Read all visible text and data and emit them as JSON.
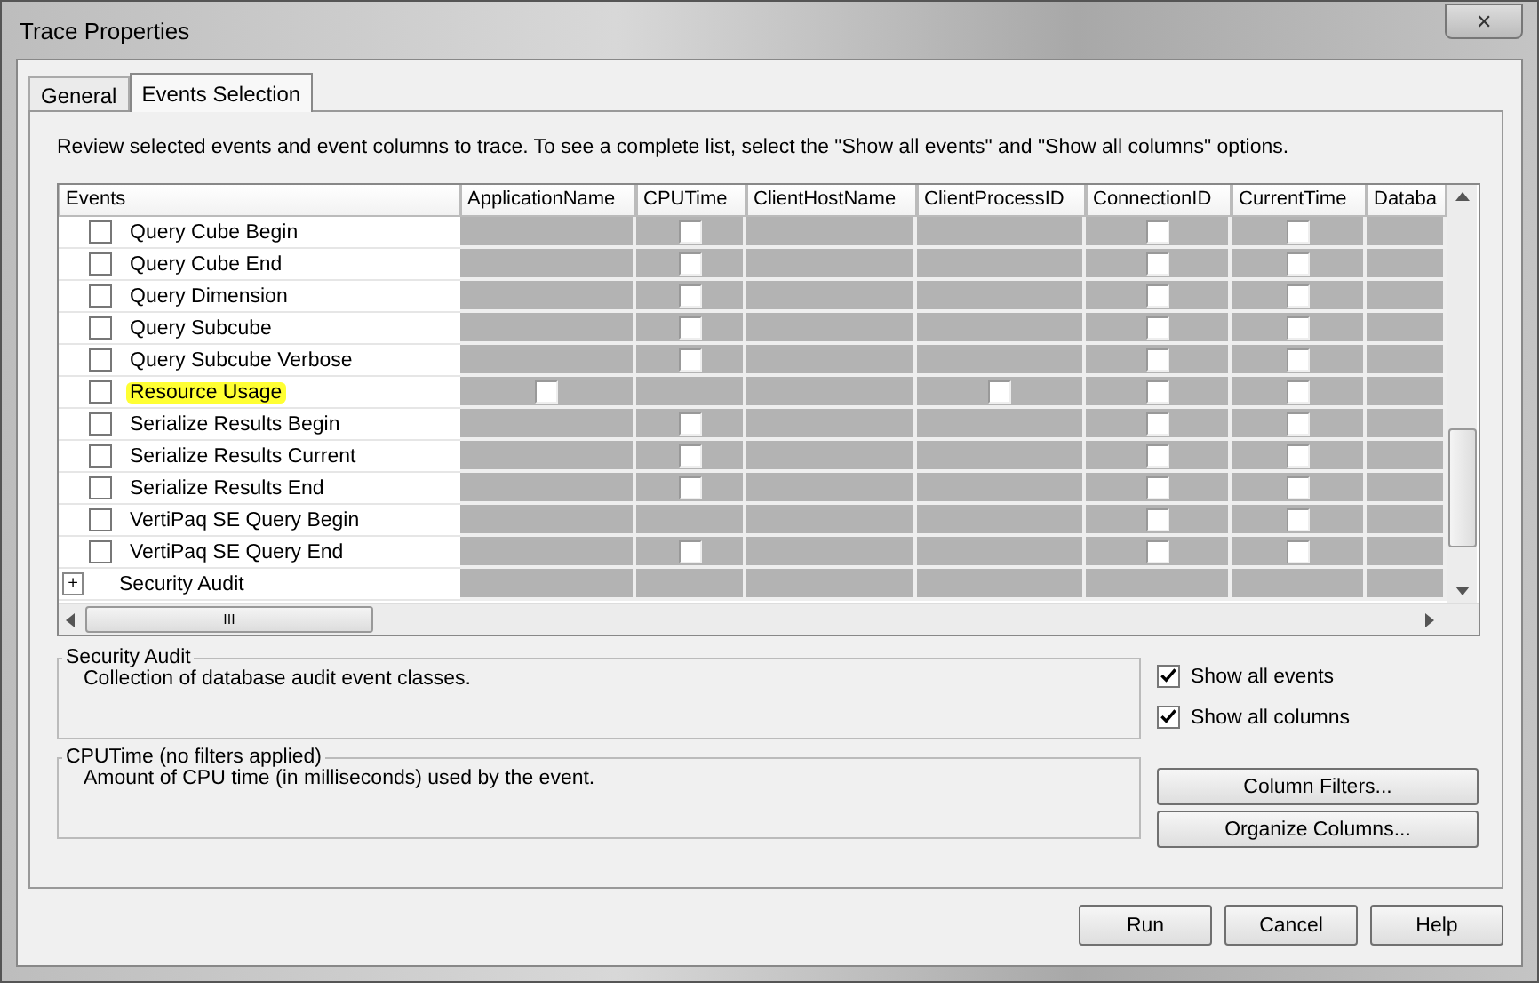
{
  "window": {
    "title": "Trace Properties",
    "close": "✕"
  },
  "tabs": [
    {
      "label": "General",
      "selected": false
    },
    {
      "label": "Events Selection",
      "selected": true
    }
  ],
  "description": "Review selected events and event columns to trace. To see a complete list, select the \"Show all events\" and \"Show all columns\" options.",
  "grid": {
    "columns": [
      "Events",
      "ApplicationName",
      "CPUTime",
      "ClientHostName",
      "ClientProcessID",
      "ConnectionID",
      "CurrentTime",
      "Databa"
    ],
    "rows": [
      {
        "event": "Query Cube Begin",
        "checked": false,
        "highlighted": false,
        "cells": [
          false,
          true,
          false,
          false,
          true,
          true,
          false
        ]
      },
      {
        "event": "Query Cube End",
        "checked": false,
        "highlighted": false,
        "cells": [
          false,
          true,
          false,
          false,
          true,
          true,
          false
        ]
      },
      {
        "event": "Query Dimension",
        "checked": false,
        "highlighted": false,
        "cells": [
          false,
          true,
          false,
          false,
          true,
          true,
          false
        ]
      },
      {
        "event": "Query Subcube",
        "checked": false,
        "highlighted": false,
        "cells": [
          false,
          true,
          false,
          false,
          true,
          true,
          false
        ]
      },
      {
        "event": "Query Subcube Verbose",
        "checked": false,
        "highlighted": false,
        "cells": [
          false,
          true,
          false,
          false,
          true,
          true,
          false
        ]
      },
      {
        "event": "Resource Usage",
        "checked": false,
        "highlighted": true,
        "cells": [
          true,
          false,
          false,
          true,
          true,
          true,
          false
        ]
      },
      {
        "event": "Serialize Results Begin",
        "checked": false,
        "highlighted": false,
        "cells": [
          false,
          true,
          false,
          false,
          true,
          true,
          false
        ]
      },
      {
        "event": "Serialize Results Current",
        "checked": false,
        "highlighted": false,
        "cells": [
          false,
          true,
          false,
          false,
          true,
          true,
          false
        ]
      },
      {
        "event": "Serialize Results End",
        "checked": false,
        "highlighted": false,
        "cells": [
          false,
          true,
          false,
          false,
          true,
          true,
          false
        ]
      },
      {
        "event": "VertiPaq SE Query Begin",
        "checked": false,
        "highlighted": false,
        "cells": [
          false,
          false,
          false,
          false,
          true,
          true,
          false
        ]
      },
      {
        "event": "VertiPaq SE Query End",
        "checked": false,
        "highlighted": false,
        "cells": [
          false,
          true,
          false,
          false,
          true,
          true,
          false
        ]
      }
    ],
    "category": {
      "label": "Security Audit",
      "expander": "+"
    },
    "hscroll_grip": "III"
  },
  "event_info": {
    "title": "Security Audit",
    "text": "Collection of database audit event classes."
  },
  "column_info": {
    "title": "CPUTime (no filters applied)",
    "text": "Amount of CPU time (in milliseconds) used by the event."
  },
  "options": [
    {
      "label": "Show all events",
      "checked": true
    },
    {
      "label": "Show all columns",
      "checked": true
    }
  ],
  "side_buttons": [
    "Column Filters...",
    "Organize Columns..."
  ],
  "buttons": [
    "Run",
    "Cancel",
    "Help"
  ]
}
